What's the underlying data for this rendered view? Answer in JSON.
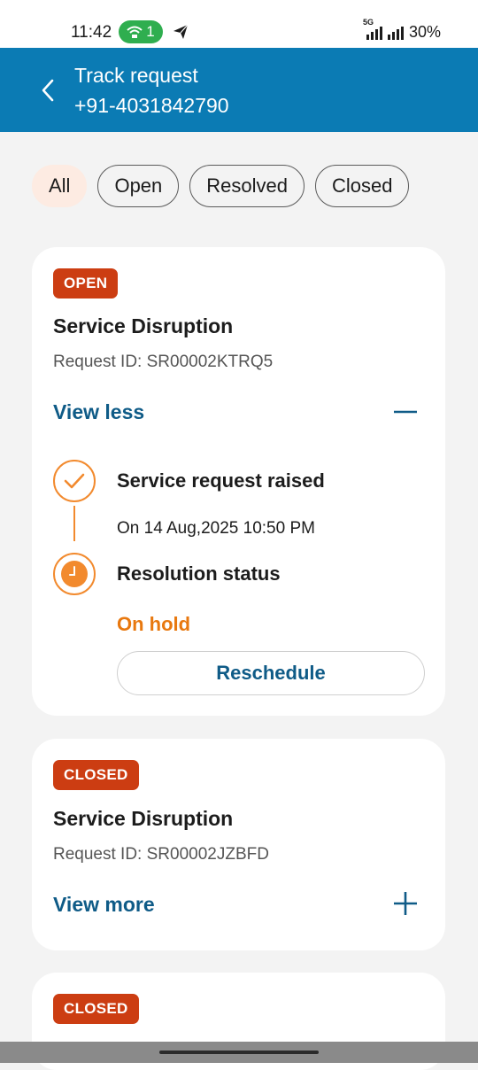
{
  "status_bar": {
    "time": "11:42",
    "hotspot_count": "1",
    "network": "5G",
    "battery": "30%"
  },
  "header": {
    "title": "Track request",
    "phone": "+91-4031842790"
  },
  "filters": [
    {
      "label": "All",
      "active": true
    },
    {
      "label": "Open",
      "active": false
    },
    {
      "label": "Resolved",
      "active": false
    },
    {
      "label": "Closed",
      "active": false
    }
  ],
  "requests": [
    {
      "status": "OPEN",
      "title": "Service Disruption",
      "request_id": "Request ID: SR00002KTRQ5",
      "toggle_label": "View less",
      "timeline": {
        "step1_title": "Service request raised",
        "step1_date": "On 14 Aug,2025 10:50 PM",
        "step2_title": "Resolution status",
        "step2_status": "On hold",
        "action_label": "Reschedule"
      }
    },
    {
      "status": "CLOSED",
      "title": "Service Disruption",
      "request_id": "Request ID: SR00002JZBFD",
      "toggle_label": "View more"
    },
    {
      "status": "CLOSED"
    }
  ],
  "colors": {
    "brand_blue": "#0b7bb4",
    "link_blue": "#0f5b87",
    "badge_red": "#cc3d12",
    "accent_orange": "#f28a2e",
    "status_orange": "#e8780f"
  }
}
